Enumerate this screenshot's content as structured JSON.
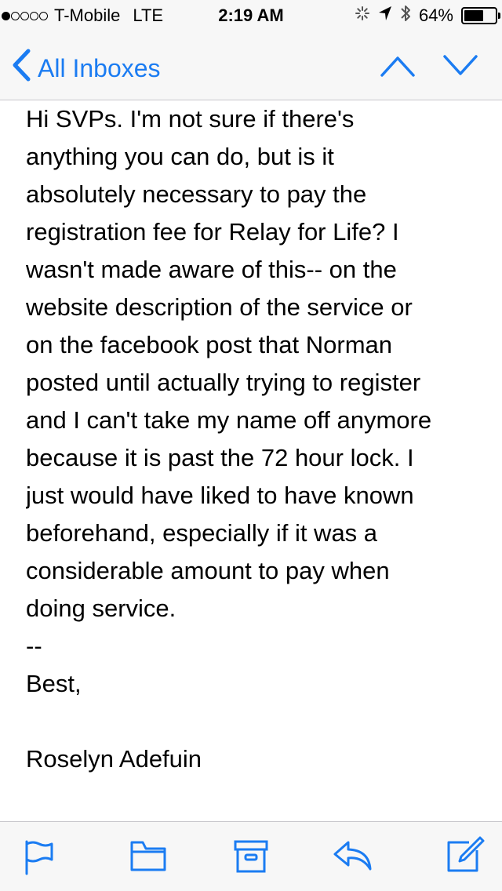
{
  "status_bar": {
    "carrier": "T-Mobile",
    "network": "LTE",
    "time": "2:19 AM",
    "battery_percent": "64%",
    "battery_level": 0.64,
    "signal_bars_filled": 1,
    "signal_bars_total": 5
  },
  "nav": {
    "back_label": "All Inboxes",
    "accent_color": "#1b7cf2"
  },
  "message": {
    "lines": [
      "Hi SVPs. I'm not sure if there's",
      "anything you can do, but is it",
      "absolutely necessary to pay the",
      "registration fee for Relay for Life? I",
      "wasn't made aware of this-- on the",
      "website description of the service or",
      "on the facebook post that Norman",
      "posted until actually trying to register",
      "and I can't take my name off anymore",
      "because it is past the 72 hour lock. I",
      "just would have liked to have known",
      "beforehand, especially if it was a",
      "considerable amount to pay when",
      "doing service."
    ],
    "signature_separator": "--",
    "closing": "Best,",
    "sender_name": "Roselyn Adefuin"
  },
  "toolbar": {
    "icons": [
      "flag-icon",
      "folder-icon",
      "archive-icon",
      "reply-icon",
      "compose-icon"
    ]
  }
}
